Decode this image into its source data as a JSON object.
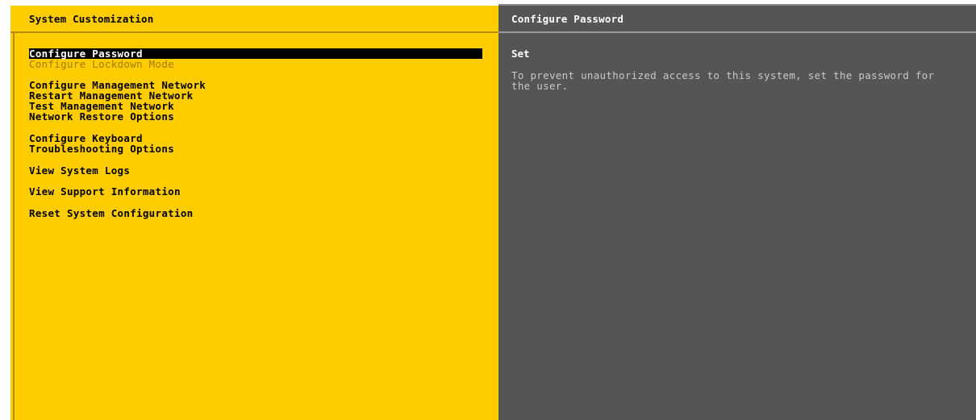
{
  "left_panel": {
    "title": "System Customization",
    "menu": [
      {
        "label": "Configure Password",
        "state": "selected"
      },
      {
        "label": "Configure Lockdown Mode",
        "state": "disabled"
      },
      {
        "label": "Configure Management Network",
        "state": "normal"
      },
      {
        "label": "Restart Management Network",
        "state": "normal"
      },
      {
        "label": "Test Management Network",
        "state": "normal"
      },
      {
        "label": "Network Restore Options",
        "state": "normal"
      },
      {
        "label": "Configure Keyboard",
        "state": "normal"
      },
      {
        "label": "Troubleshooting Options",
        "state": "normal"
      },
      {
        "label": "View System Logs",
        "state": "normal"
      },
      {
        "label": "View Support Information",
        "state": "normal"
      },
      {
        "label": "Reset System Configuration",
        "state": "normal"
      }
    ]
  },
  "right_panel": {
    "title": "Configure Password",
    "status": "Set",
    "description": "To prevent unauthorized access to this system, set the password for the user."
  },
  "colors": {
    "left_background": "#ffcc00",
    "right_background": "#555555",
    "selection_background": "#000000",
    "disabled_text": "#a07d00"
  }
}
